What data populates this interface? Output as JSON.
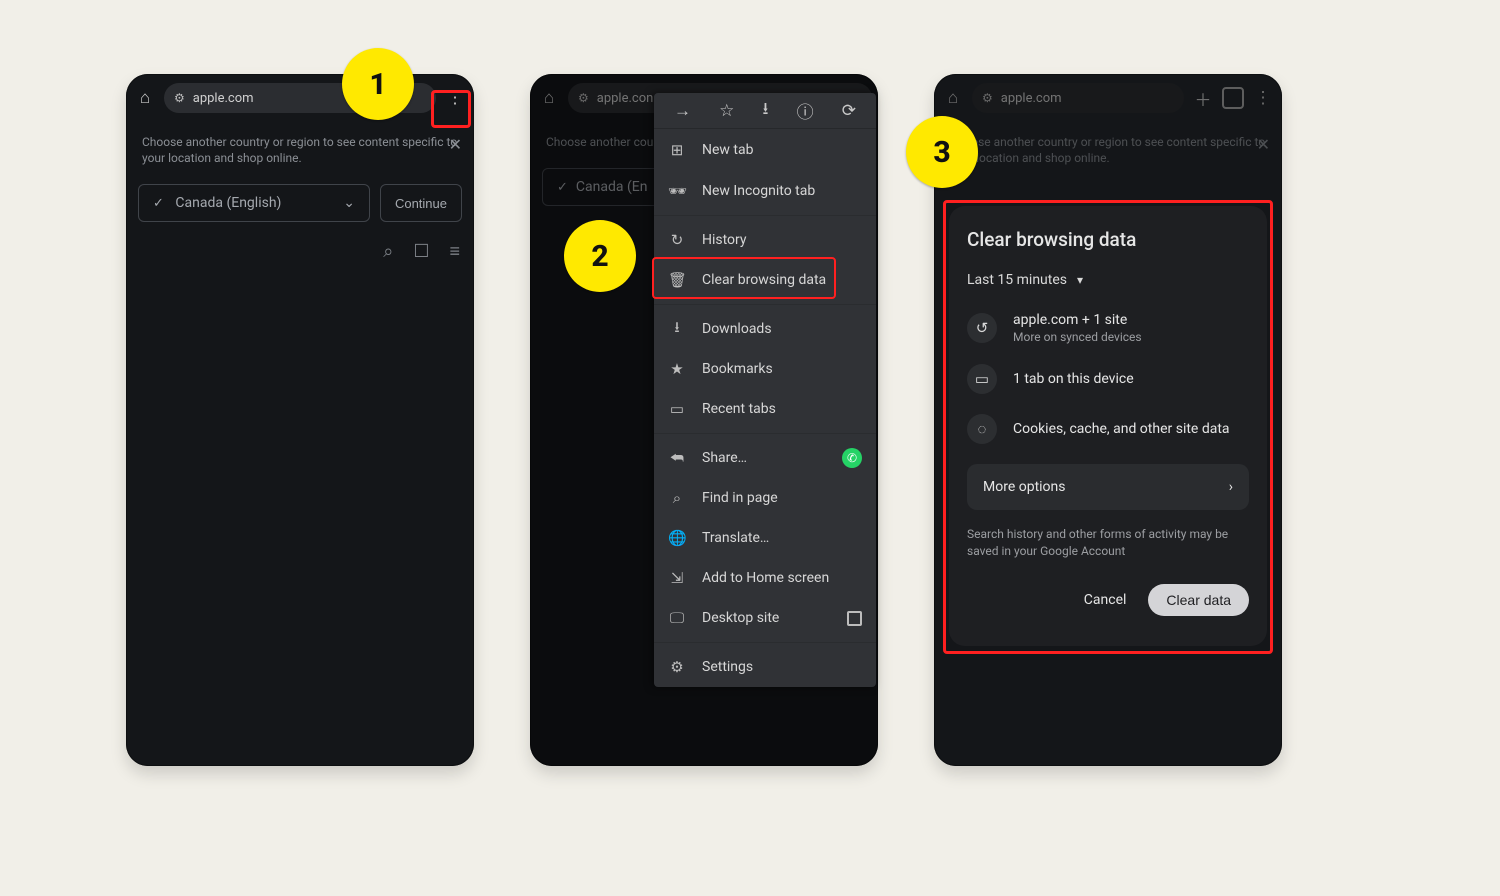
{
  "step_labels": {
    "s1": "1",
    "s2": "2",
    "s3": "3"
  },
  "bg": {
    "url": "apple.com",
    "url_short": "apple.con",
    "banner": "Choose another country or region to see content specific to your location and shop online.",
    "region": "Canada (English)",
    "continue": "Continue"
  },
  "menu": {
    "new_tab": "New tab",
    "incognito": "New Incognito tab",
    "history": "History",
    "clear": "Clear browsing data",
    "downloads": "Downloads",
    "bookmarks": "Bookmarks",
    "recent": "Recent tabs",
    "share": "Share…",
    "find": "Find in page",
    "translate": "Translate…",
    "addhome": "Add to Home screen",
    "desktop": "Desktop site",
    "settings": "Settings"
  },
  "dialog": {
    "title": "Clear browsing data",
    "range": "Last 15 minutes",
    "site_line": "apple.com + 1 site",
    "site_sub": "More on synced devices",
    "tabs_line": "1 tab on this device",
    "cookies_line": "Cookies, cache, and other site data",
    "more": "More options",
    "note": "Search history and other forms of activity may be saved in your Google Account",
    "cancel": "Cancel",
    "clear": "Clear data"
  }
}
